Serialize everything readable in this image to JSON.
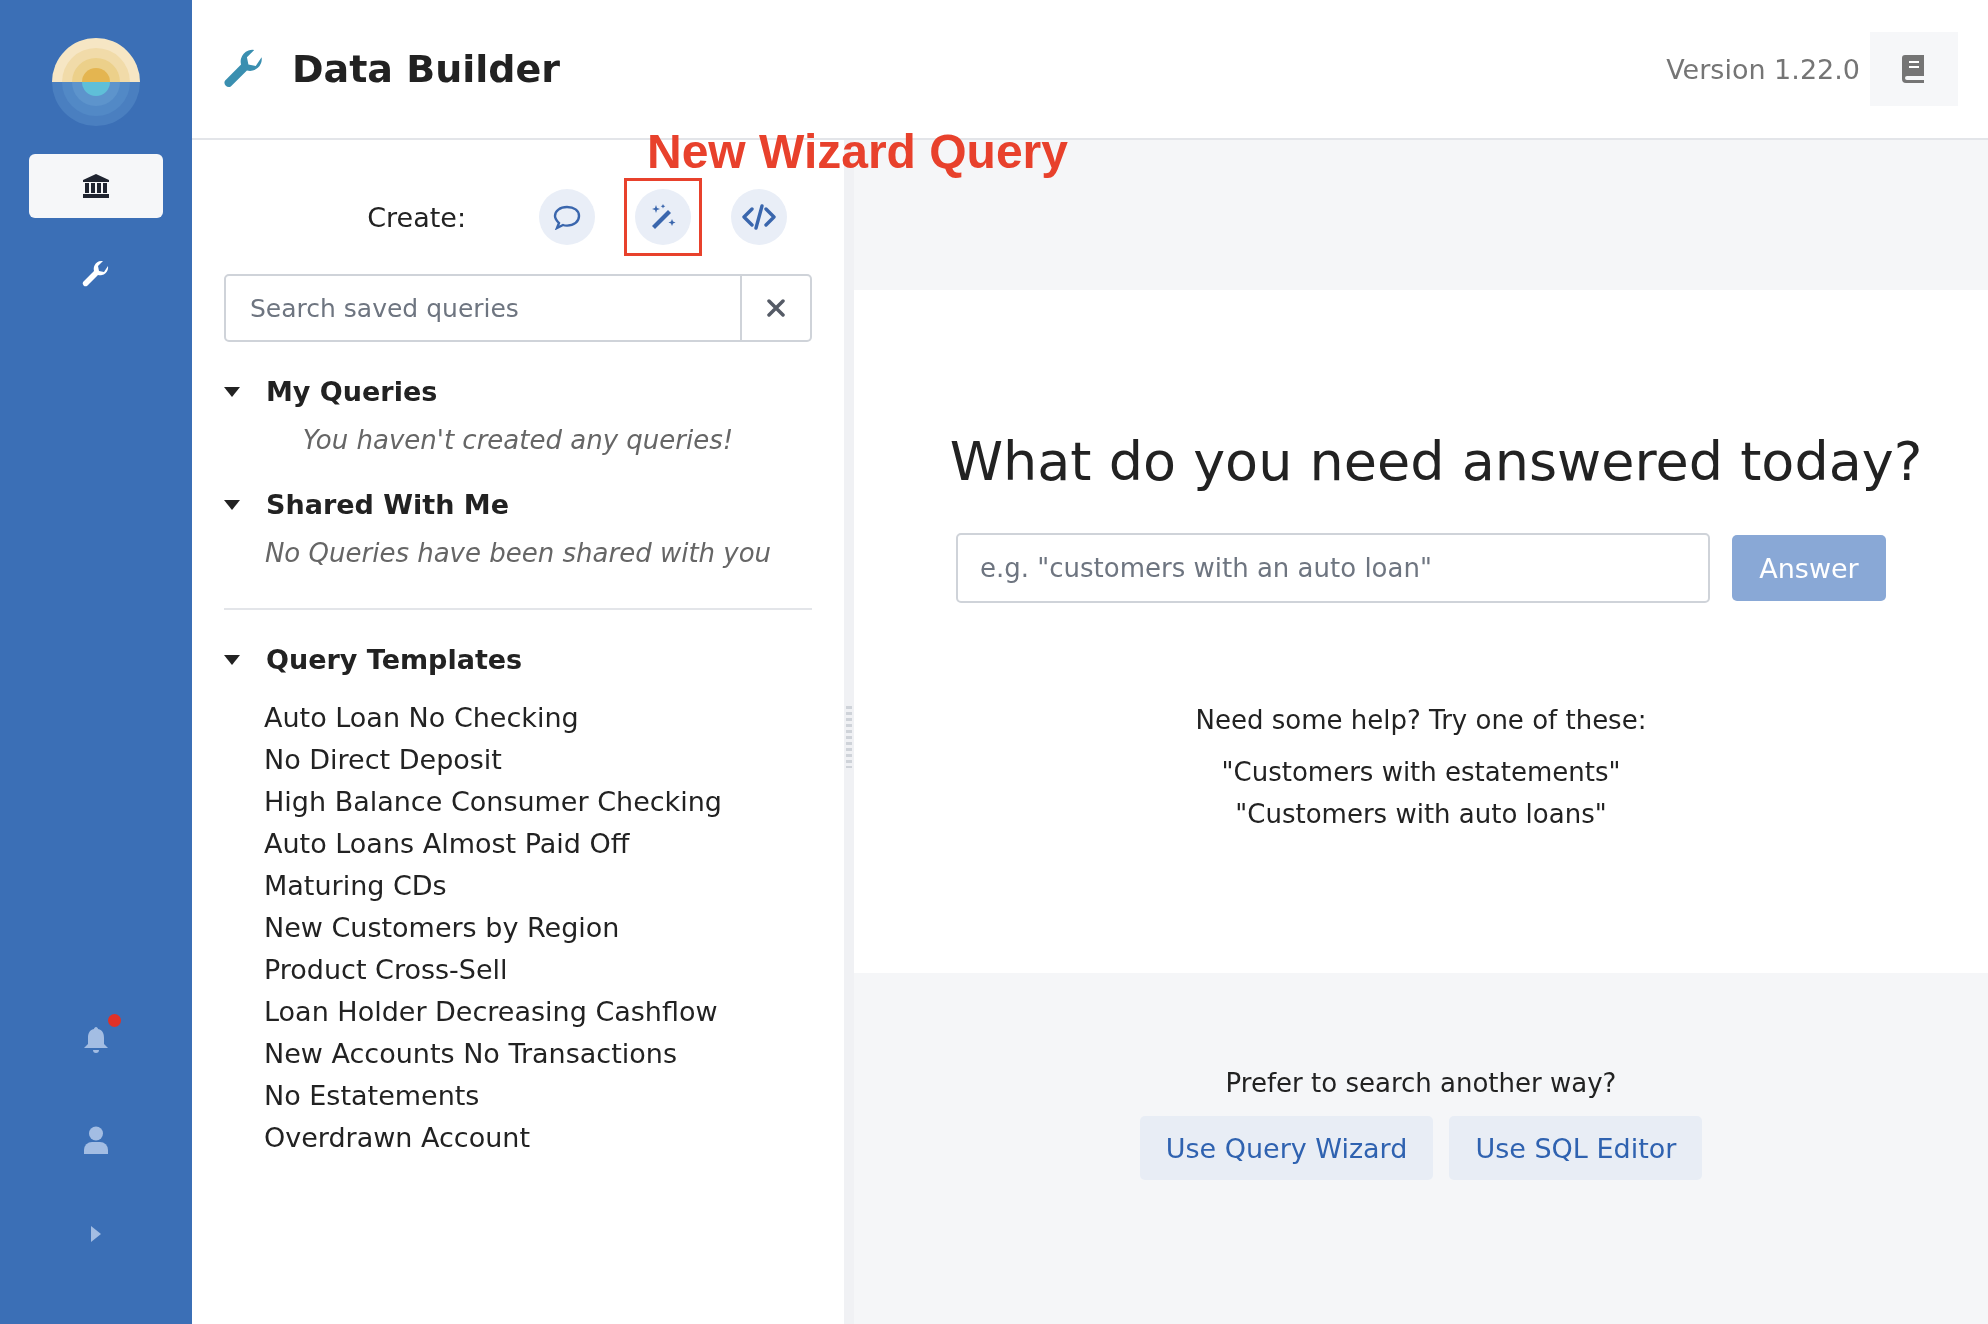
{
  "sidebar": {
    "nav": [
      {
        "kind": "bank",
        "selected": true
      },
      {
        "kind": "wrench",
        "selected": false
      }
    ],
    "notifications": {
      "unread": true
    }
  },
  "header": {
    "title": "Data Builder",
    "version": "Version 1.22.0"
  },
  "create": {
    "label": "Create:",
    "buttons": [
      {
        "kind": "chat",
        "highlighted": false
      },
      {
        "kind": "wizard",
        "highlighted": true
      },
      {
        "kind": "code",
        "highlighted": false
      }
    ],
    "annotation": "New Wizard Query"
  },
  "search": {
    "placeholder": "Search saved queries"
  },
  "sections": [
    {
      "title": "My Queries",
      "expanded": true,
      "empty_message": "You haven't created any queries!"
    },
    {
      "title": "Shared With Me",
      "expanded": true,
      "empty_message": "No Queries have been shared with you"
    }
  ],
  "templates": {
    "title": "Query Templates",
    "expanded": true,
    "items": [
      "Auto Loan No Checking",
      "No Direct Deposit",
      "High Balance Consumer Checking",
      "Auto Loans Almost Paid Off",
      "Maturing CDs",
      "New Customers by Region",
      "Product Cross-Sell",
      "Loan Holder Decreasing Cashflow",
      "New Accounts No Transactions",
      "No Estatements",
      "Overdrawn Account"
    ]
  },
  "answer": {
    "heading": "What do you need answered today?",
    "placeholder": "e.g. \"customers with an auto loan\"",
    "button": {
      "label": "Answer",
      "disabled": true
    },
    "help_title": "Need some help? Try one of these:",
    "suggestions": [
      "\"Customers with estatements\"",
      "\"Customers with auto loans\""
    ]
  },
  "alternatives": {
    "title": "Prefer to search another way?",
    "buttons": [
      "Use Query Wizard",
      "Use SQL Editor"
    ]
  }
}
